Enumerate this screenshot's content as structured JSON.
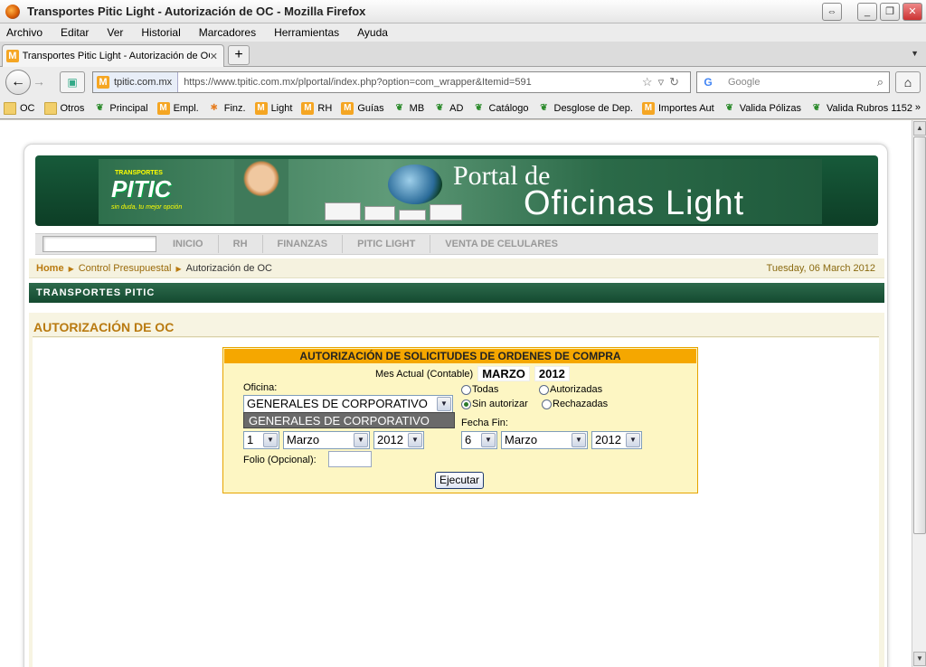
{
  "window": {
    "title": "Transportes Pitic Light - Autorización de OC - Mozilla Firefox",
    "controls": [
      "⇔",
      "_",
      "❐",
      "✕"
    ]
  },
  "menu": [
    "Archivo",
    "Editar",
    "Ver",
    "Historial",
    "Marcadores",
    "Herramientas",
    "Ayuda"
  ],
  "tab": {
    "label": "Transportes Pitic Light - Autorización de OC",
    "close": "✕",
    "new": "+"
  },
  "navbar": {
    "site": "tpitic.com.mx",
    "url": "https://www.tpitic.com.mx/plportal/index.php?option=com_wrapper&Itemid=591",
    "search_placeholder": "Google"
  },
  "bookmarks": [
    {
      "label": "OC",
      "icon": "folder"
    },
    {
      "label": "Otros",
      "icon": "folder"
    },
    {
      "label": "Principal",
      "icon": "leaf"
    },
    {
      "label": "Empl.",
      "icon": "m"
    },
    {
      "label": "Finz.",
      "icon": "star"
    },
    {
      "label": "Light",
      "icon": "m"
    },
    {
      "label": "RH",
      "icon": "m"
    },
    {
      "label": "Guías",
      "icon": "m"
    },
    {
      "label": "MB",
      "icon": "leaf"
    },
    {
      "label": "AD",
      "icon": "leaf"
    },
    {
      "label": "Catálogo",
      "icon": "leaf"
    },
    {
      "label": "Desglose de Dep.",
      "icon": "leaf"
    },
    {
      "label": "Importes Aut",
      "icon": "m"
    },
    {
      "label": "Valida Pólizas",
      "icon": "leaf"
    },
    {
      "label": "Valida Rubros 1152",
      "icon": "leaf"
    }
  ],
  "bookmarks_more": "»",
  "banner": {
    "logo_top": "TRANSPORTES",
    "logo": "PITIC",
    "logo_tag": "sin duda, tu mejor opción",
    "line1": "Portal de",
    "line2": "Oficinas Light"
  },
  "site_nav": [
    "INICIO",
    "RH",
    "FINANZAS",
    "PITIC LIGHT",
    "VENTA DE CELULARES"
  ],
  "breadcrumb": {
    "home": "Home",
    "section": "Control Presupuestal",
    "current": "Autorización de OC",
    "date": "Tuesday, 06 March 2012"
  },
  "company": "TRANSPORTES PITIC",
  "page_title": "AUTORIZACIÓN DE OC",
  "form": {
    "header": "AUTORIZACIÓN DE SOLICITUDES DE ORDENES DE COMPRA",
    "mes_label": "Mes Actual (Contable)",
    "mes_value": "MARZO",
    "anio_value": "2012",
    "oficina_label": "Oficina:",
    "oficina_value": "GENERALES DE CORPORATIVO",
    "oficina_option": "GENERALES DE CORPORATIVO",
    "radios": {
      "todas": "Todas",
      "autorizadas": "Autorizadas",
      "sin_autorizar": "Sin autorizar",
      "rechazadas": "Rechazadas",
      "selected": "sin_autorizar"
    },
    "fecha_fin_label": "Fecha Fin:",
    "start": {
      "day": "1",
      "month": "Marzo",
      "year": "2012"
    },
    "end": {
      "day": "6",
      "month": "Marzo",
      "year": "2012"
    },
    "folio_label": "Folio (Opcional):",
    "folio_value": "",
    "submit": "Ejecutar"
  }
}
